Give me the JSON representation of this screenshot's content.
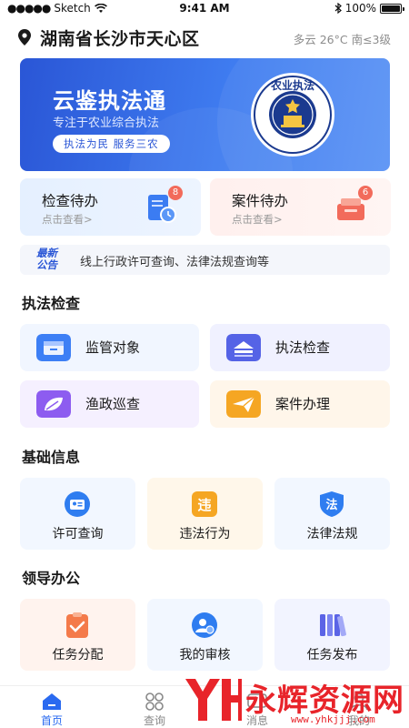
{
  "status_bar": {
    "carrier": "Sketch",
    "time": "9:41 AM",
    "battery": "100%"
  },
  "header": {
    "location": "湖南省长沙市天心区",
    "weather": "多云 26°C 南≤3级"
  },
  "banner": {
    "title": "云鉴执法通",
    "subtitle": "专注于农业综合执法",
    "tagline": "执法为民 服务三农",
    "emblem_top_text": "农业执法",
    "emblem_ring_text": "AGRICULTURAL LAW ENFORCEMENT"
  },
  "todos": [
    {
      "title": "检查待办",
      "sub": "点击查看>",
      "count": "8"
    },
    {
      "title": "案件待办",
      "sub": "点击查看>",
      "count": "6"
    }
  ],
  "notice": {
    "label_1": "最新",
    "label_2": "公告",
    "text": "线上行政许可查询、法律法规查询等"
  },
  "sections": {
    "enforcement": {
      "title": "执法检查",
      "items": [
        {
          "label": "监管对象",
          "icon": "archive-icon",
          "color": "#3d7ff5"
        },
        {
          "label": "执法检查",
          "icon": "scan-icon",
          "color": "#5563e6"
        },
        {
          "label": "渔政巡查",
          "icon": "leaf-icon",
          "color": "#8d5cf0"
        },
        {
          "label": "案件办理",
          "icon": "send-icon",
          "color": "#f5a623"
        }
      ]
    },
    "basic": {
      "title": "基础信息",
      "items": [
        {
          "label": "许可查询",
          "icon": "id-card-icon",
          "color": "#2f7df0"
        },
        {
          "label": "违法行为",
          "icon": "violation-icon",
          "color": "#f5a623"
        },
        {
          "label": "法律法规",
          "icon": "law-shield-icon",
          "color": "#2f7df0"
        }
      ]
    },
    "leader": {
      "title": "领导办公",
      "items": [
        {
          "label": "任务分配",
          "icon": "clipboard-check-icon",
          "color": "#f47a4a"
        },
        {
          "label": "我的审核",
          "icon": "user-review-icon",
          "color": "#2f7df0"
        },
        {
          "label": "任务发布",
          "icon": "books-icon",
          "color": "#5b64e6"
        }
      ]
    }
  },
  "tabbar": [
    {
      "label": "首页",
      "icon": "home-icon"
    },
    {
      "label": "查询",
      "icon": "grid-icon"
    },
    {
      "label": "消息",
      "icon": "message-icon"
    },
    {
      "label": "我的",
      "icon": "user-icon"
    }
  ],
  "watermark": {
    "text": "永辉资源网",
    "url": "www.yhkjjj.com"
  }
}
